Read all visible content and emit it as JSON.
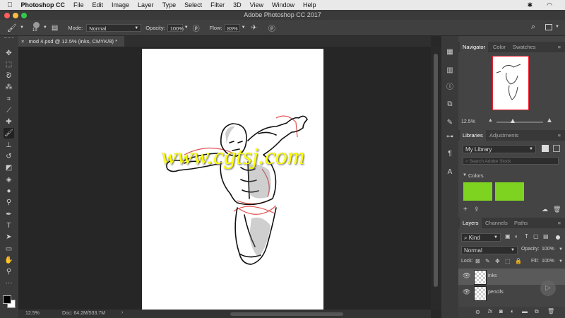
{
  "menubar": {
    "app_name": "Photoshop CC",
    "items": [
      "File",
      "Edit",
      "Image",
      "Layer",
      "Type",
      "Select",
      "Filter",
      "3D",
      "View",
      "Window",
      "Help"
    ]
  },
  "window": {
    "title": "Adobe Photoshop CC 2017"
  },
  "options": {
    "brush_size": "19",
    "mode_label": "Mode:",
    "mode_value": "Normal",
    "opacity_label": "Opacity:",
    "opacity_value": "100%",
    "flow_label": "Flow:",
    "flow_value": "83%"
  },
  "document": {
    "tab_title": "mod 4.psd @ 12.5% (inks, CMYK/8) *",
    "watermark": "www.cgtsj.com"
  },
  "status": {
    "zoom": "12.5%",
    "doc_size": "Doc: 64.2M/533.7M"
  },
  "navigator": {
    "tabs": [
      "Navigator",
      "Color",
      "Swatches"
    ],
    "zoom": "12.5%"
  },
  "libraries": {
    "tabs": [
      "Libraries",
      "Adjustments"
    ],
    "library_name": "My Library",
    "search_placeholder": "Search Adobe Stock",
    "colors_label": "Colors",
    "swatch_color": "#7ed321"
  },
  "layers": {
    "tabs": [
      "Layers",
      "Channels",
      "Paths"
    ],
    "filter_kind": "Kind",
    "blend_mode": "Normal",
    "opacity_label": "Opacity:",
    "opacity_value": "100%",
    "lock_label": "Lock:",
    "fill_label": "Fill:",
    "fill_value": "100%",
    "items": [
      {
        "name": "inks"
      },
      {
        "name": "pencils"
      }
    ]
  },
  "colors": {
    "accent": "#4a90d9",
    "watermark": "#ffff00",
    "pencil": "#d33"
  }
}
